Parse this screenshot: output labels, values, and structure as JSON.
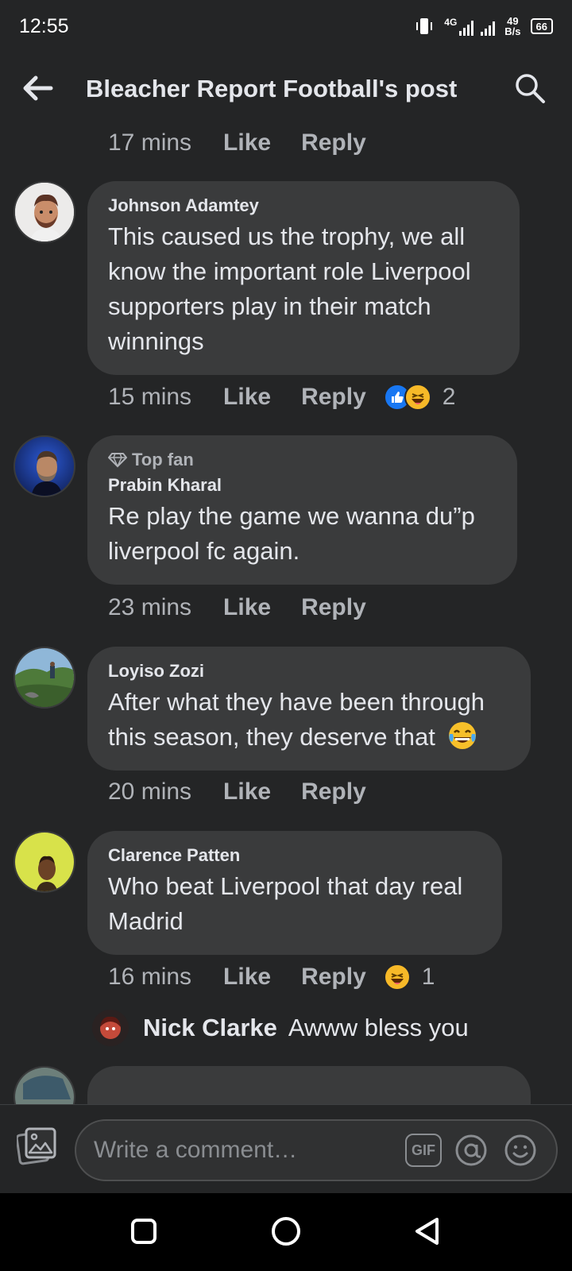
{
  "status_bar": {
    "time": "12:55",
    "network": "4G",
    "speed_value": "49",
    "speed_unit": "B/s",
    "battery": "66"
  },
  "header": {
    "title": "Bleacher Report Football's post",
    "back_icon": "arrow-left-icon",
    "search_icon": "search-icon"
  },
  "actions": {
    "like_label": "Like",
    "reply_label": "Reply"
  },
  "top_meta": {
    "time": "17 mins"
  },
  "comments": [
    {
      "author": "Johnson Adamtey",
      "badge": "",
      "text": "This caused us the trophy, we all know the important role Liverpool supporters play in their match winnings",
      "time": "15 mins",
      "reactions": [
        "like",
        "haha"
      ],
      "reaction_count": "2"
    },
    {
      "author": "Prabin Kharal",
      "badge": "Top fan",
      "text": "Re play the game we wanna du”p liverpool fc again.",
      "time": "23 mins",
      "reactions": [],
      "reaction_count": ""
    },
    {
      "author": "Loyiso Zozi",
      "badge": "",
      "text": "After what they have been through this season,  they deserve that",
      "time": "20 mins",
      "reactions": [],
      "reaction_count": ""
    },
    {
      "author": "Clarence Patten",
      "badge": "",
      "text": "Who beat Liverpool that day real Madrid",
      "time": "16 mins",
      "reactions": [
        "haha"
      ],
      "reaction_count": "1"
    }
  ],
  "reply_preview": {
    "name": "Nick Clarke",
    "text": "Awww bless you"
  },
  "composer": {
    "placeholder": "Write a comment…",
    "gif_label": "GIF"
  },
  "colors": {
    "background": "#242526",
    "bubble": "#3a3b3c",
    "text": "#e4e6eb",
    "secondary": "#b0b3b8",
    "like_blue": "#1877f2",
    "haha_yellow": "#f7b928"
  }
}
